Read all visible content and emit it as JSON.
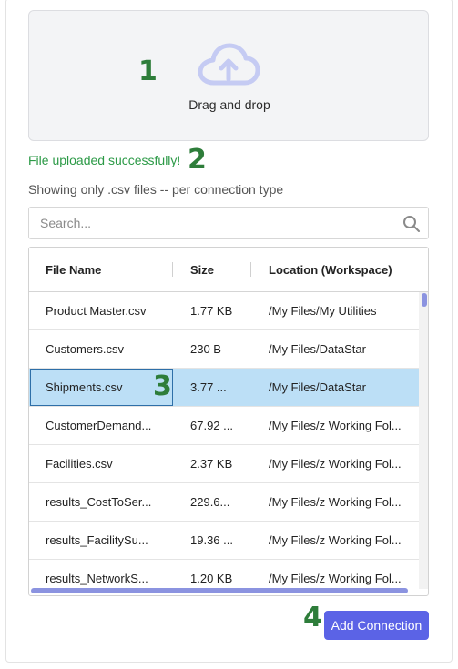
{
  "dropzone": {
    "label": "Drag and drop",
    "icon": "cloud-upload-icon"
  },
  "status": {
    "success": "File uploaded successfully!"
  },
  "info": "Showing only .csv files -- per connection type",
  "search": {
    "placeholder": "Search...",
    "value": ""
  },
  "table": {
    "columns": [
      "File Name",
      "Size",
      "Location (Workspace)"
    ],
    "rows": [
      {
        "name": "Product Master.csv",
        "size": "1.77 KB",
        "location": "/My Files/My Utilities"
      },
      {
        "name": "Customers.csv",
        "size": "230 B",
        "location": "/My Files/DataStar"
      },
      {
        "name": "Shipments.csv",
        "size": "3.77 ...",
        "location": "/My Files/DataStar",
        "selected": true
      },
      {
        "name": "CustomerDemand...",
        "size": "67.92 ...",
        "location": "/My Files/z Working Fol..."
      },
      {
        "name": "Facilities.csv",
        "size": "2.37 KB",
        "location": "/My Files/z Working Fol..."
      },
      {
        "name": "results_CostToSer...",
        "size": "229.6...",
        "location": "/My Files/z Working Fol..."
      },
      {
        "name": "results_FacilitySu...",
        "size": "19.36 ...",
        "location": "/My Files/z Working Fol..."
      },
      {
        "name": "results_NetworkS...",
        "size": "1.20 KB",
        "location": "/My Files/z Working Fol..."
      }
    ]
  },
  "actions": {
    "add_connection": "Add Connection"
  },
  "annotations": [
    "1",
    "2",
    "3",
    "4"
  ],
  "colors": {
    "accent": "#5b63e6",
    "success": "#2c9a47",
    "selected_row": "#bcdff6",
    "marker": "#2e7d3a"
  }
}
